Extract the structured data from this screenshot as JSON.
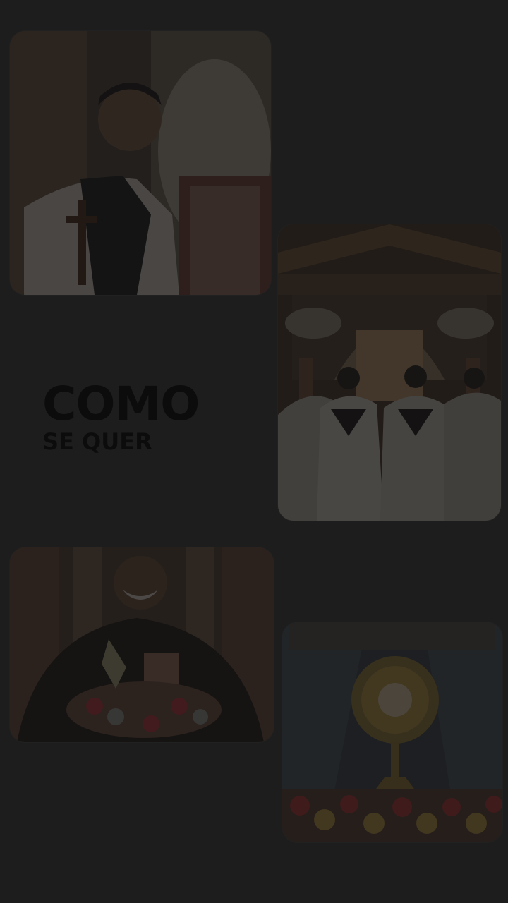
{
  "headline": {
    "title": "COMO",
    "subtitle": "SE QUER"
  },
  "photos": [
    {
      "name": "photo-priest-holding-cross",
      "accent": "#8a8276"
    },
    {
      "name": "photo-altar-ceremony",
      "accent": "#5a4436"
    },
    {
      "name": "photo-smiling-seminarian",
      "accent": "#3a2a22"
    },
    {
      "name": "photo-monstrance-flowers",
      "accent": "#6b5a2e"
    }
  ],
  "colors": {
    "background": "#1d1d1d",
    "headline_text": "#0c0c0c"
  }
}
